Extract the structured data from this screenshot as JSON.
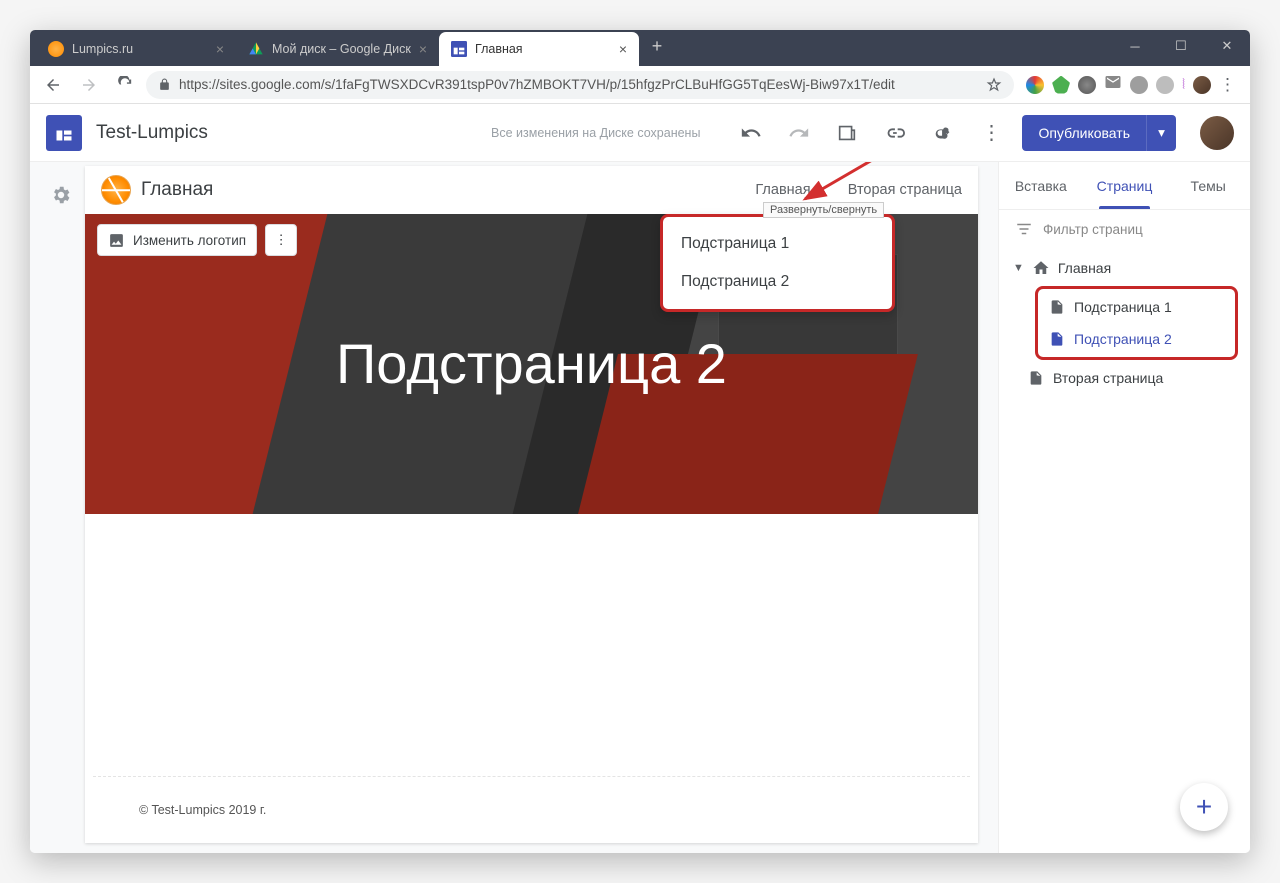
{
  "browser": {
    "tabs": [
      {
        "title": "Lumpics.ru",
        "fav": "#ff8c00"
      },
      {
        "title": "Мой диск – Google Диск",
        "fav": "drive"
      },
      {
        "title": "Главная",
        "fav": "sites"
      }
    ],
    "url": "https://sites.google.com/s/1faFgTWSXDCvR391tspP0v7hZMBOKT7VH/p/15hfgzPrCLBuHfGG5TqEesWj-Biw97x1T/edit"
  },
  "app": {
    "site_name": "Test-Lumpics",
    "save_state": "Все изменения на Диске сохранены",
    "publish_label": "Опубликовать"
  },
  "page": {
    "title": "Главная",
    "nav": [
      {
        "label": "Главная",
        "has_children": true
      },
      {
        "label": "Вторая страница",
        "has_children": false
      }
    ],
    "change_logo": "Изменить логотип",
    "hero_title": "Подстраница 2",
    "footer": "© Test-Lumpics 2019 г.",
    "tooltip": "Развернуть/свернуть",
    "dropdown": [
      "Подстраница 1",
      "Подстраница 2"
    ]
  },
  "sidebar": {
    "tabs": [
      "Вставка",
      "Страниц",
      "Темы"
    ],
    "active_tab": 1,
    "filter": "Фильтр страниц",
    "tree": {
      "root": {
        "label": "Главная",
        "icon": "home"
      },
      "children": [
        {
          "label": "Подстраница 1",
          "selected": false
        },
        {
          "label": "Подстраница 2",
          "selected": true
        }
      ],
      "sibling": {
        "label": "Вторая страница"
      }
    }
  }
}
